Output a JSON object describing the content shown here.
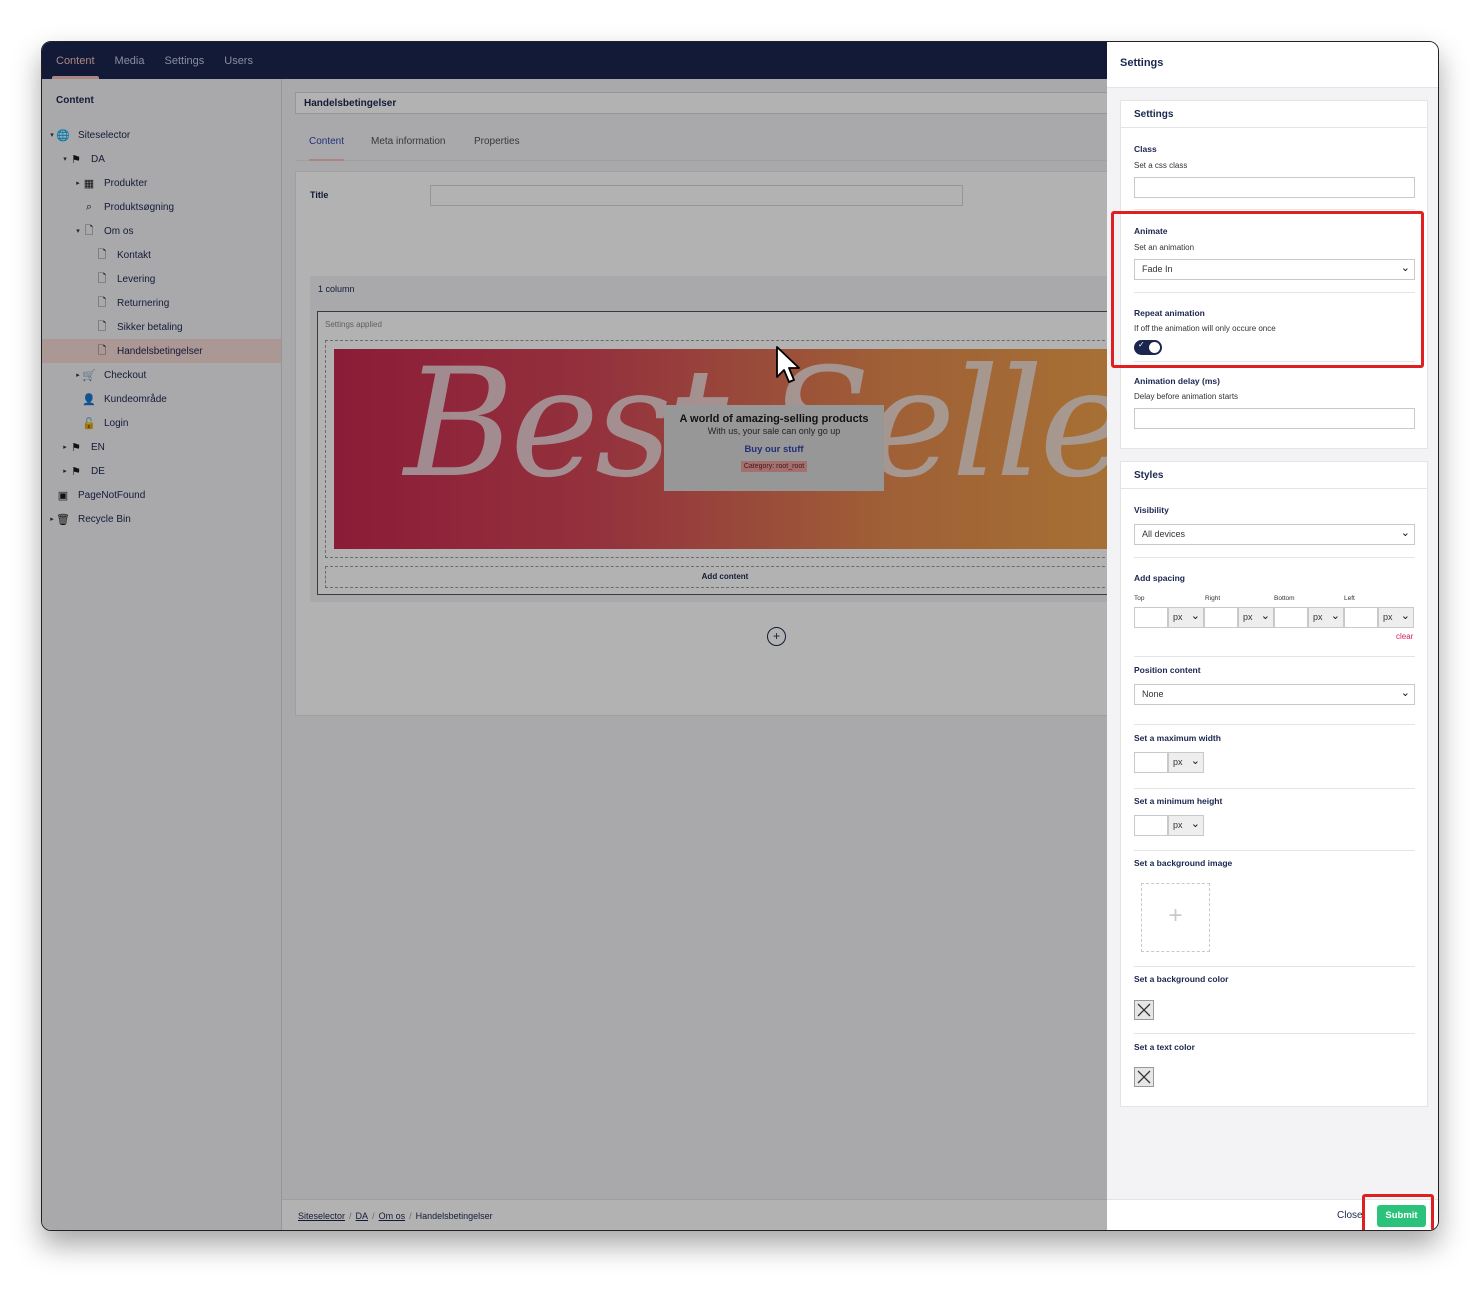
{
  "topnav": {
    "tabs": [
      "Content",
      "Media",
      "Settings",
      "Users"
    ],
    "active": "Content"
  },
  "sidebar": {
    "title": "Content",
    "tree": [
      {
        "label": "Siteselector",
        "icon": "globe-icon",
        "caret": true
      },
      {
        "label": "DA",
        "icon": "flag-icon",
        "caret": true
      },
      {
        "label": "Produkter",
        "icon": "grid-icon",
        "caret": true
      },
      {
        "label": "Produktsøgning",
        "icon": "search-icon",
        "caret": false
      },
      {
        "label": "Om os",
        "icon": "document-icon",
        "caret": true
      },
      {
        "label": "Kontakt",
        "icon": "document-icon",
        "caret": false
      },
      {
        "label": "Levering",
        "icon": "document-icon",
        "caret": false
      },
      {
        "label": "Returnering",
        "icon": "document-icon",
        "caret": false
      },
      {
        "label": "Sikker betaling",
        "icon": "document-icon",
        "caret": false
      },
      {
        "label": "Handelsbetingelser",
        "icon": "document-icon",
        "caret": false,
        "active": true
      },
      {
        "label": "Checkout",
        "icon": "cart-icon",
        "caret": true
      },
      {
        "label": "Kundeområde",
        "icon": "user-icon",
        "caret": false
      },
      {
        "label": "Login",
        "icon": "unlock-icon",
        "caret": false
      },
      {
        "label": "EN",
        "icon": "flag-icon",
        "caret": true
      },
      {
        "label": "DE",
        "icon": "flag-icon",
        "caret": true
      },
      {
        "label": "PageNotFound",
        "icon": "page-not-found-icon",
        "caret": false
      },
      {
        "label": "Recycle Bin",
        "icon": "trash-icon",
        "caret": true
      }
    ]
  },
  "main": {
    "document_name": "Handelsbetingelser",
    "tabs": [
      "Content",
      "Meta information",
      "Properties"
    ],
    "active_tab": "Content",
    "title_label": "Title",
    "title_value": "",
    "grid": {
      "column_label": "1 column",
      "settings_applied": "Settings applied",
      "banner_text": "Best Sellers",
      "promo": {
        "heading": "A world of amazing-selling products",
        "subheading": "With us, your sale can only go up",
        "link": "Buy our stuff",
        "category": "Category: root_root"
      },
      "add_content": "Add content"
    },
    "breadcrumb": [
      "Siteselector",
      "DA",
      "Om os",
      "Handelsbetingelser"
    ]
  },
  "panel": {
    "title": "Settings",
    "settings_box": {
      "title": "Settings",
      "class_label": "Class",
      "class_desc": "Set a css class",
      "class_value": "",
      "animate_label": "Animate",
      "animate_desc": "Set an animation",
      "animate_value": "Fade In",
      "repeat_label": "Repeat animation",
      "repeat_desc": "If off the animation will only occure once",
      "repeat_on": true,
      "delay_label": "Animation delay (ms)",
      "delay_desc": "Delay before animation starts",
      "delay_value": ""
    },
    "styles_box": {
      "title": "Styles",
      "visibility_label": "Visibility",
      "visibility_value": "All devices",
      "spacing_label": "Add spacing",
      "spacing_sides": [
        "Top",
        "Right",
        "Bottom",
        "Left"
      ],
      "spacing_unit": "px",
      "clear": "clear",
      "position_label": "Position content",
      "position_value": "None",
      "max_width_label": "Set a maximum width",
      "min_height_label": "Set a minimum height",
      "unit": "px",
      "bg_image_label": "Set a background image",
      "bg_color_label": "Set a background color",
      "text_color_label": "Set a text color"
    },
    "close_label": "Close",
    "submit_label": "Submit"
  },
  "colors": {
    "nav_bg": "#1b264f",
    "accent": "#f5c1bc",
    "submit": "#2bc37c",
    "highlight": "#e02020"
  }
}
